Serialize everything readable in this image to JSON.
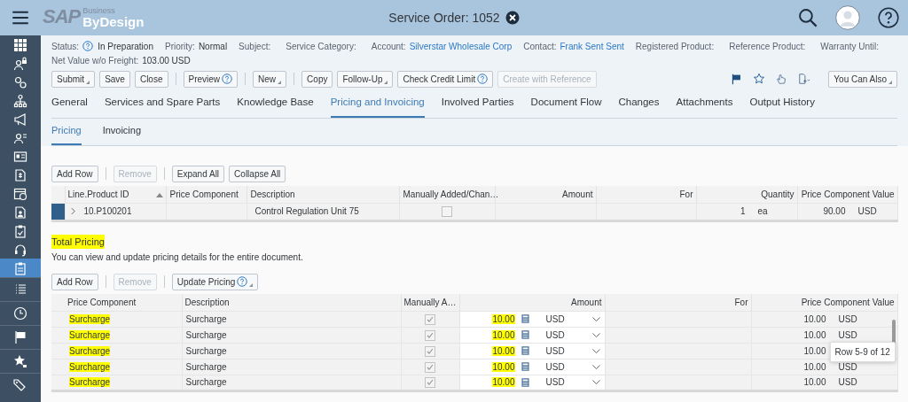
{
  "header": {
    "logo_sap": "SAP",
    "logo_top": "Business",
    "logo_main": "ByDesign",
    "title": "Service Order: 1052"
  },
  "sidebar": {
    "apps": [
      {
        "selected": false
      },
      {
        "selected": false
      },
      {
        "selected": false
      },
      {
        "selected": false
      },
      {
        "selected": false
      },
      {
        "selected": false
      },
      {
        "selected": false
      },
      {
        "selected": false
      },
      {
        "selected": false
      },
      {
        "selected": false
      },
      {
        "selected": false
      },
      {
        "selected": false
      },
      {
        "selected": true
      }
    ],
    "tools": [
      {
        "selected": false
      },
      {
        "selected": false
      },
      {
        "selected": false
      },
      {
        "selected": false
      },
      {
        "selected": false
      }
    ]
  },
  "field_rows": [
    [
      {
        "label": "Status:",
        "help": true,
        "value": "In Preparation",
        "kind": "text"
      },
      {
        "label": "Priority:",
        "value": "Normal",
        "kind": "text"
      },
      {
        "label": "Subject:"
      },
      {
        "label": "Service Category:"
      },
      {
        "label": "Account:",
        "value": "Silverstar Wholesale Corp",
        "kind": "link"
      },
      {
        "label": "Contact:",
        "value": "Frank Sent Sent",
        "kind": "link"
      },
      {
        "label": "Registered Product:"
      },
      {
        "label": "Reference Product:"
      },
      {
        "label": "Warranty Until:"
      }
    ],
    [
      {
        "label": "Net Value w/o Freight:",
        "value": "103.00 USD",
        "kind": "text"
      }
    ]
  ],
  "toolbar": {
    "groups": [
      [
        {
          "label": "Submit",
          "menu": true,
          "help": false,
          "disabled": false
        },
        {
          "label": "Save",
          "menu": false,
          "help": false,
          "disabled": false
        },
        {
          "label": "Close",
          "menu": false,
          "help": false,
          "disabled": false
        }
      ],
      [
        {
          "label": "Preview",
          "menu": false,
          "help": true,
          "disabled": false
        }
      ],
      [
        {
          "label": "New",
          "menu": true,
          "help": false,
          "disabled": false
        }
      ],
      [
        {
          "label": "Copy",
          "menu": false,
          "help": false,
          "disabled": false
        },
        {
          "label": "Follow-Up",
          "menu": true,
          "help": false,
          "disabled": false
        },
        {
          "label": "Check Credit Limit",
          "menu": false,
          "help": true,
          "disabled": false
        },
        {
          "label": "Create with Reference",
          "menu": false,
          "help": false,
          "disabled": true
        }
      ]
    ],
    "more": {
      "label": "You Can Also",
      "menu": true
    }
  },
  "tabs": [
    {
      "label": "General",
      "selected": false
    },
    {
      "label": "Services and Spare Parts",
      "selected": false
    },
    {
      "label": "Knowledge Base",
      "selected": false
    },
    {
      "label": "Pricing and Invoicing",
      "selected": true
    },
    {
      "label": "Involved Parties",
      "selected": false
    },
    {
      "label": "Document Flow",
      "selected": false
    },
    {
      "label": "Changes",
      "selected": false
    },
    {
      "label": "Attachments",
      "selected": false
    },
    {
      "label": "Output History",
      "selected": false
    }
  ],
  "subtabs": [
    {
      "label": "Pricing",
      "selected": true
    },
    {
      "label": "Invoicing",
      "selected": false
    }
  ],
  "line_items": {
    "buttons": [
      {
        "label": "Add Row",
        "disabled": false,
        "menu": false,
        "help": false
      },
      {
        "label": "Remove",
        "disabled": true,
        "menu": false,
        "help": false
      },
      {
        "label": "Expand All",
        "disabled": false,
        "menu": false,
        "help": false
      },
      {
        "label": "Collapse All",
        "disabled": false,
        "menu": false,
        "help": false
      }
    ],
    "columns": [
      {
        "label": "Line.Product ID",
        "sorted_ascending": true,
        "kind": "text"
      },
      {
        "label": "Price Component",
        "kind": "text"
      },
      {
        "label": "Description",
        "kind": "text"
      },
      {
        "label": "Manually Added/Chan…",
        "kind": "check"
      },
      {
        "label": "Amount",
        "kind": "number"
      },
      {
        "label": "For",
        "kind": "number"
      },
      {
        "label": "Quantity",
        "kind": "number"
      },
      {
        "label": "Price Component Value",
        "kind": "number"
      }
    ],
    "rows": [
      {
        "selected": true,
        "expanded": false,
        "product_id": "10.P100201",
        "description": "Control Regulation Unit 75",
        "manual": false,
        "quantity": "1",
        "unit": "ea",
        "value": "90.00",
        "currency": "USD"
      }
    ]
  },
  "total_pricing": {
    "title": "Total Pricing",
    "title_highlighted": true,
    "description": "You can view and update pricing details for the entire document.",
    "buttons": [
      {
        "label": "Add Row",
        "disabled": false,
        "menu": false,
        "help": false
      },
      {
        "label": "Remove",
        "disabled": true,
        "menu": false,
        "help": false
      },
      {
        "label": "Update Pricing",
        "disabled": false,
        "menu": true,
        "help": true
      }
    ],
    "columns": [
      {
        "label": "Price Component",
        "kind": "text"
      },
      {
        "label": "Description",
        "kind": "text"
      },
      {
        "label": "Manually A…",
        "kind": "check"
      },
      {
        "label": "Amount",
        "kind": "number"
      },
      {
        "label": "For",
        "kind": "number"
      },
      {
        "label": "Price Component Value",
        "kind": "number"
      }
    ],
    "rows": [
      {
        "component": "Surcharge",
        "component_highlighted": true,
        "description": "Surcharge",
        "manual": true,
        "amount": "10.00",
        "amount_highlighted": true,
        "amount_currency": "USD",
        "value": "10.00",
        "currency": "USD"
      },
      {
        "component": "Surcharge",
        "component_highlighted": true,
        "description": "Surcharge",
        "manual": true,
        "amount": "10.00",
        "amount_highlighted": true,
        "amount_currency": "USD",
        "value": "10.00",
        "currency": "USD"
      },
      {
        "component": "Surcharge",
        "component_highlighted": true,
        "description": "Surcharge",
        "manual": true,
        "amount": "10.00",
        "amount_highlighted": true,
        "amount_currency": "USD",
        "value": "10.00"
      },
      {
        "component": "Surcharge",
        "component_highlighted": true,
        "description": "Surcharge",
        "manual": true,
        "amount": "10.00",
        "amount_highlighted": true,
        "amount_currency": "USD",
        "value": "10.00",
        "currency": "USD"
      },
      {
        "component": "Surcharge",
        "component_highlighted": true,
        "description": "Surcharge",
        "manual": true,
        "amount": "10.00",
        "amount_highlighted": true,
        "amount_currency": "USD",
        "value": "10.00",
        "currency": "USD"
      }
    ],
    "tooltip": "Row 5-9 of 12"
  }
}
